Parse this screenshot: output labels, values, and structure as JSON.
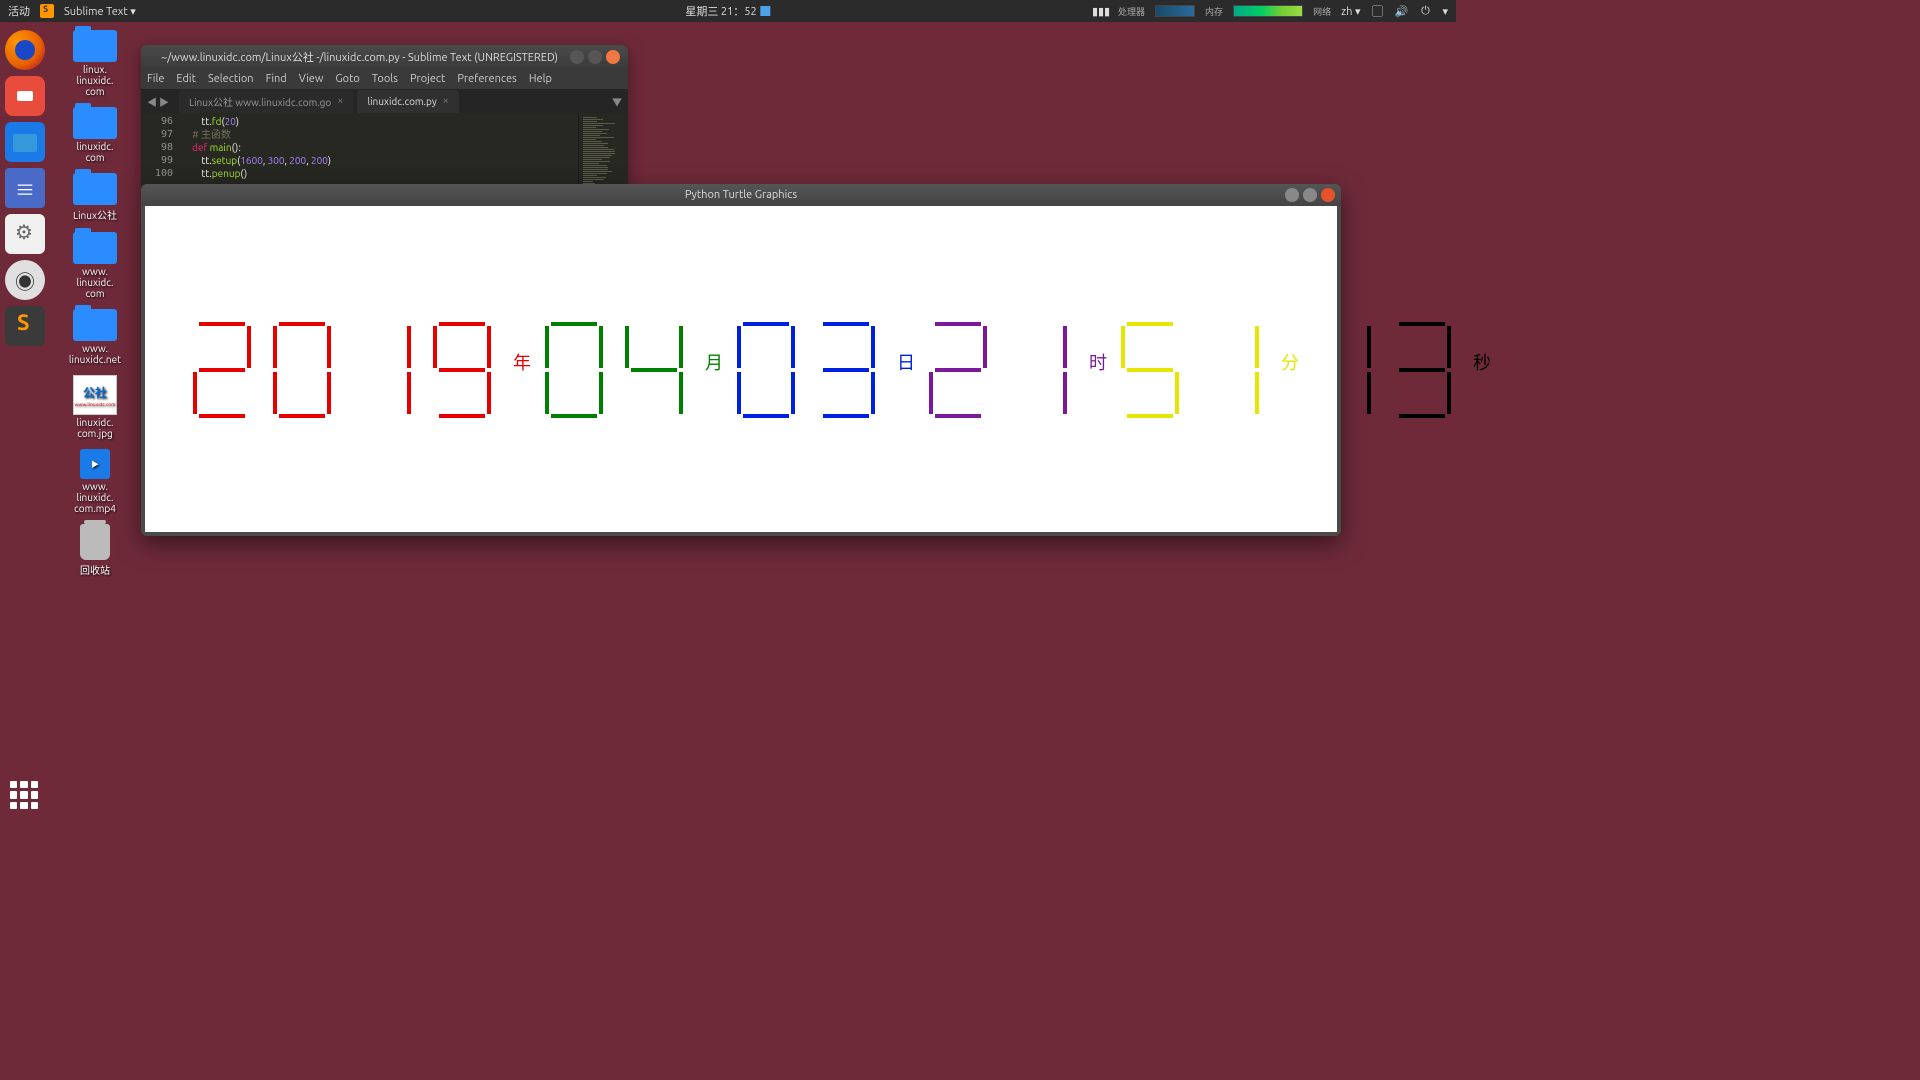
{
  "topbar": {
    "activities": "活动",
    "app_name": "Sublime Text",
    "date": "星期三 21：52",
    "cpu_label": "处理器",
    "mem_label": "内存",
    "net_label": "网络",
    "lang": "zh"
  },
  "desktop_icons": [
    "linux.\nlinuxidc.\ncom",
    "linuxidc.\ncom",
    "Linux公社",
    "www.\nlinuxidc.\ncom",
    "www.\nlinuxidc.net",
    "linuxidc.\ncom.jpg",
    "www.\nlinuxidc.\ncom.mp4",
    "回收站"
  ],
  "sublime": {
    "title": "~/www.linuxidc.com/Linux公社 -/linuxidc.com.py - Sublime Text (UNREGISTERED)",
    "menu": [
      "File",
      "Edit",
      "Selection",
      "Find",
      "View",
      "Goto",
      "Tools",
      "Project",
      "Preferences",
      "Help"
    ],
    "tabs": [
      {
        "label": "Linux公社 www.linuxidc.com.go",
        "active": false
      },
      {
        "label": "linuxidc.com.py",
        "active": true
      }
    ],
    "gutter": [
      "96",
      "97",
      "98",
      "99",
      "100"
    ],
    "code_lines": [
      {
        "indent": "        ",
        "parts": [
          {
            "t": "tt.",
            "c": ""
          },
          {
            "t": "fd",
            "c": "fn"
          },
          {
            "t": "(",
            "c": ""
          },
          {
            "t": "20",
            "c": "num"
          },
          {
            "t": ")",
            "c": ""
          }
        ]
      },
      {
        "indent": "    ",
        "parts": [
          {
            "t": "# 主函数",
            "c": "com"
          }
        ]
      },
      {
        "indent": "    ",
        "parts": [
          {
            "t": "def ",
            "c": "kw"
          },
          {
            "t": "main",
            "c": "fn"
          },
          {
            "t": "():",
            "c": ""
          }
        ]
      },
      {
        "indent": "        ",
        "parts": [
          {
            "t": "tt.",
            "c": ""
          },
          {
            "t": "setup",
            "c": "fn"
          },
          {
            "t": "(",
            "c": ""
          },
          {
            "t": "1600",
            "c": "num"
          },
          {
            "t": ", ",
            "c": ""
          },
          {
            "t": "300",
            "c": "num"
          },
          {
            "t": ", ",
            "c": ""
          },
          {
            "t": "200",
            "c": "num"
          },
          {
            "t": ", ",
            "c": ""
          },
          {
            "t": "200",
            "c": "num"
          },
          {
            "t": ")",
            "c": ""
          }
        ]
      },
      {
        "indent": "        ",
        "parts": [
          {
            "t": "tt.",
            "c": ""
          },
          {
            "t": "penup",
            "c": "fn"
          },
          {
            "t": "()",
            "c": ""
          }
        ]
      }
    ]
  },
  "turtle": {
    "title": "Python Turtle Graphics",
    "groups": [
      {
        "color": "#e60000",
        "digits": [
          "2",
          "0",
          "1",
          "9"
        ],
        "label": "年",
        "label_color": "#e60000"
      },
      {
        "color": "#008000",
        "digits": [
          "0",
          "4"
        ],
        "label": "月",
        "label_color": "#008000"
      },
      {
        "color": "#0020e0",
        "digits": [
          "0",
          "3"
        ],
        "label": "日",
        "label_color": "#0020e0"
      },
      {
        "color": "#7a1a9a",
        "digits": [
          "2",
          "1"
        ],
        "label": "时",
        "label_color": "#7a1a9a"
      },
      {
        "color": "#e6e600",
        "digits": [
          "5",
          "1"
        ],
        "label": "分",
        "label_color": "#e6e600"
      },
      {
        "color": "#000000",
        "digits": [
          "1",
          "3"
        ],
        "label": "秒",
        "label_color": "#000000"
      }
    ]
  },
  "seg_map": {
    "0": "abcdef",
    "1": "bc",
    "2": "abged",
    "3": "abgcd",
    "4": "fgbc",
    "5": "afgcd",
    "6": "afgedc",
    "7": "abc",
    "8": "abcdefg",
    "9": "abcfgd"
  }
}
